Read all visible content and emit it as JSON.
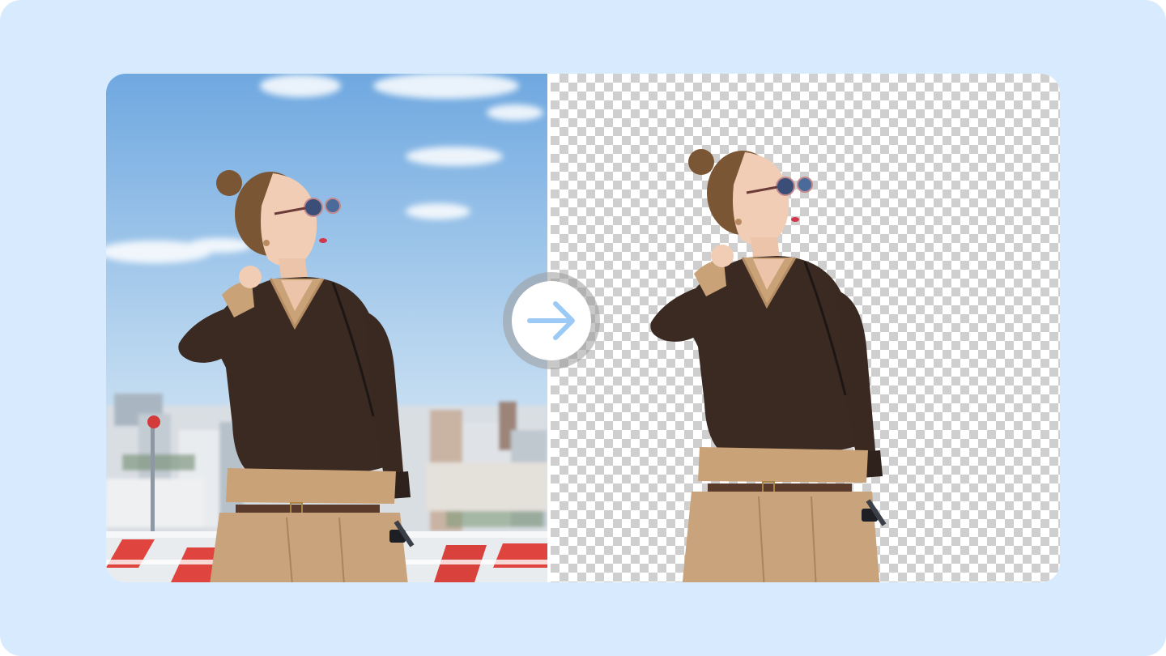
{
  "comparison": {
    "before": {
      "background": "sky-and-city-photo"
    },
    "after": {
      "background": "transparent-checkerboard"
    },
    "arrow": {
      "icon": "arrow-right-icon",
      "color": "#9ccaf6"
    }
  },
  "colors": {
    "page_background": "#d8eafe",
    "sky_top": "#7fb3e6",
    "sky_bottom": "#e8f1f8",
    "sweater": "#3b2a22",
    "pants": "#c9a37b",
    "checker_dark": "#cfcfcf",
    "arrow": "#9ccaf6"
  }
}
